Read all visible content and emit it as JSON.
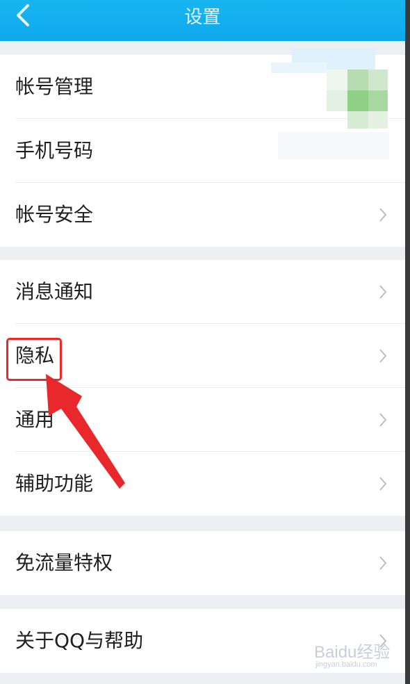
{
  "header": {
    "title": "设置"
  },
  "groups": [
    {
      "items": [
        {
          "label": "帐号管理"
        },
        {
          "label": "手机号码"
        },
        {
          "label": "帐号安全"
        }
      ]
    },
    {
      "items": [
        {
          "label": "消息通知"
        },
        {
          "label": "隐私"
        },
        {
          "label": "通用"
        },
        {
          "label": "辅助功能"
        }
      ]
    },
    {
      "items": [
        {
          "label": "免流量特权"
        }
      ]
    },
    {
      "items": [
        {
          "label": "关于QQ与帮助"
        }
      ]
    }
  ],
  "watermark": {
    "brand": "Baidu经验",
    "sub": "jingyan.baidu.com"
  },
  "colors": {
    "header": "#0fa8ec",
    "highlight": "#ea2a2a"
  },
  "icons": [
    "back-arrow-icon",
    "chevron-right-icon"
  ]
}
